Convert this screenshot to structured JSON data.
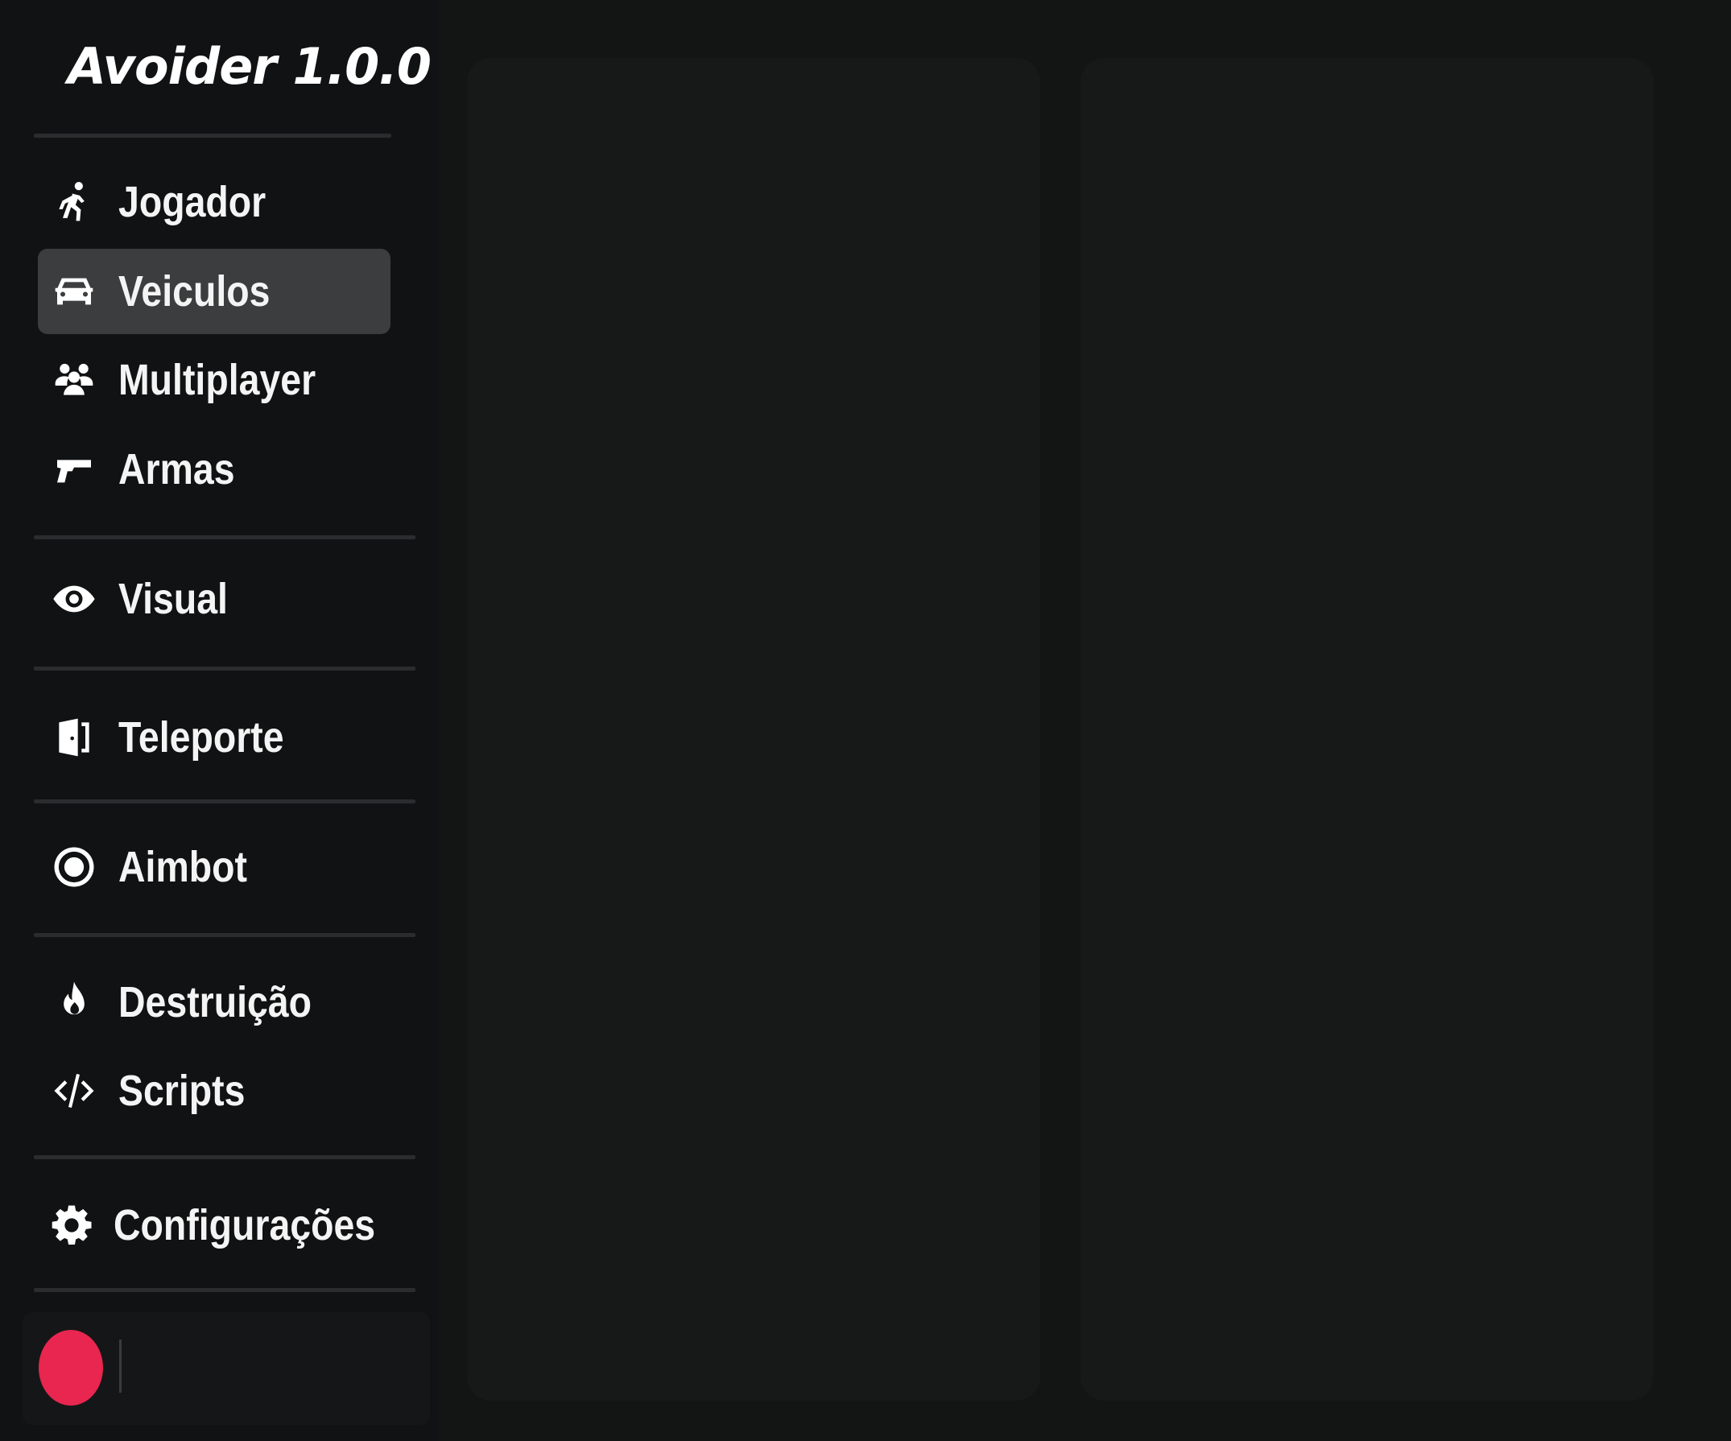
{
  "app": {
    "title": "Avoider 1.0.0"
  },
  "sidebar": {
    "items": [
      {
        "label": "Jogador",
        "icon": "running-person-icon",
        "active": false
      },
      {
        "label": "Veiculos",
        "icon": "car-icon",
        "active": true
      },
      {
        "label": "Multiplayer",
        "icon": "users-group-icon",
        "active": false
      },
      {
        "label": "Armas",
        "icon": "pistol-icon",
        "active": false
      },
      {
        "label": "Visual",
        "icon": "eye-icon",
        "active": false
      },
      {
        "label": "Teleporte",
        "icon": "door-icon",
        "active": false
      },
      {
        "label": "Aimbot",
        "icon": "target-icon",
        "active": false
      },
      {
        "label": "Destruição",
        "icon": "fire-icon",
        "active": false
      },
      {
        "label": "Scripts",
        "icon": "code-icon",
        "active": false
      },
      {
        "label": "Configurações",
        "icon": "gear-icon",
        "active": false
      }
    ]
  },
  "user": {
    "avatar_color": "#e8264f"
  },
  "colors": {
    "background": "#131414",
    "sidebar": "#111213",
    "active_item": "#3c3d3e",
    "panel": "#171818",
    "accent": "#e8264f"
  }
}
